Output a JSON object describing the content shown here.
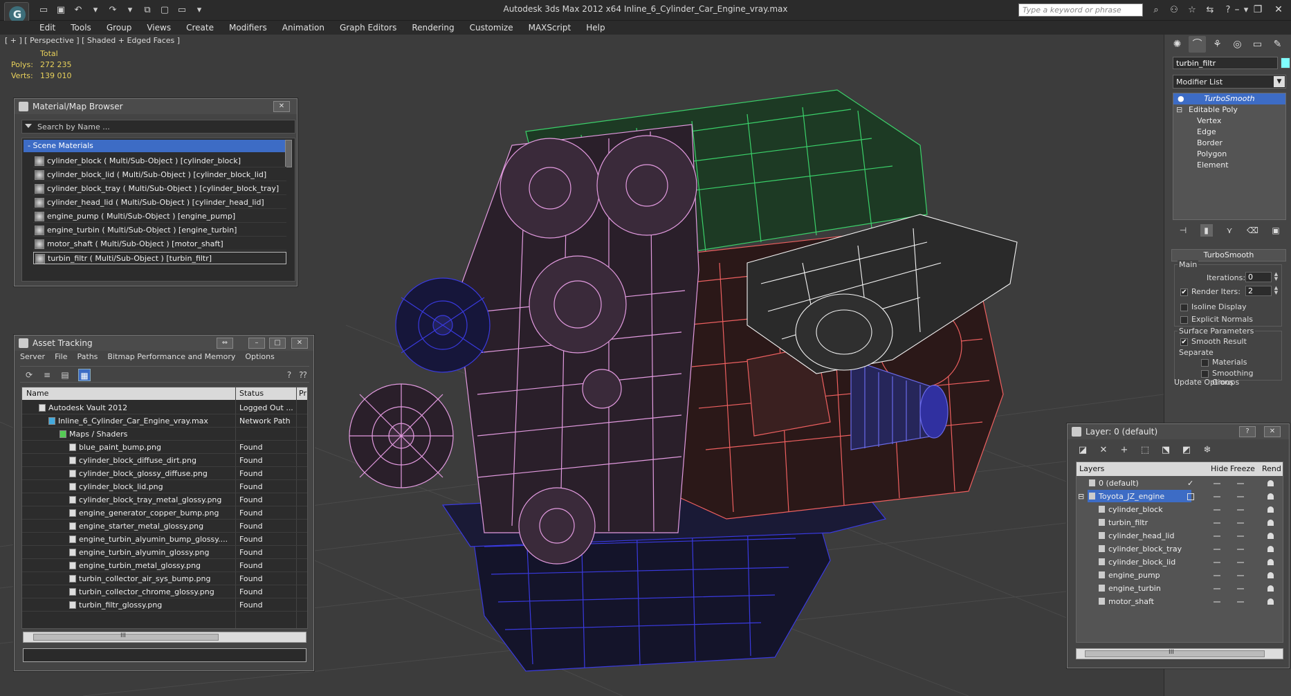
{
  "app": {
    "window_title": "Autodesk 3ds Max  2012 x64      Inline_6_Cylinder_Car_Engine_vray.max",
    "logo_letter": "G"
  },
  "search": {
    "placeholder": "Type a keyword or phrase"
  },
  "menu": [
    "Edit",
    "Tools",
    "Group",
    "Views",
    "Create",
    "Modifiers",
    "Animation",
    "Graph Editors",
    "Rendering",
    "Customize",
    "MAXScript",
    "Help"
  ],
  "viewport": {
    "label": "[ + ] [ Perspective ] [ Shaded + Edged Faces ]",
    "stats": {
      "header": "Total",
      "polys_label": "Polys:",
      "polys": "272 235",
      "verts_label": "Verts:",
      "verts": "139 010"
    }
  },
  "command_panel": {
    "object_name": "turbin_filtr",
    "object_color": "#80ffff",
    "modifier_list": "Modifier List",
    "stack": {
      "turbosmooth": "TurboSmooth",
      "editable_poly": "Editable Poly",
      "subobjects": [
        "Vertex",
        "Edge",
        "Border",
        "Polygon",
        "Element"
      ]
    },
    "turbosmooth": {
      "title": "TurboSmooth",
      "main_label": "Main",
      "iterations_label": "Iterations:",
      "iterations": "0",
      "render_iters_label": "Render Iters:",
      "render_iters": "2",
      "render_iters_checked": "✔",
      "isoline_label": "Isoline Display",
      "explicit_normals_label": "Explicit Normals",
      "surface_params_label": "Surface Parameters",
      "smooth_result_label": "Smooth Result",
      "smooth_result_checked": "✔",
      "separate_label": "Separate",
      "materials_label": "Materials",
      "smoothing_groups_label": "Smoothing Groups",
      "update_options_label": "Update Options"
    }
  },
  "material_browser": {
    "title": "Material/Map Browser",
    "search_placeholder": "Search by Name ...",
    "category": "- Scene Materials",
    "materials": [
      "cylinder_block  ( Multi/Sub-Object ) [cylinder_block]",
      "cylinder_block_lid  ( Multi/Sub-Object ) [cylinder_block_lid]",
      "cylinder_block_tray  ( Multi/Sub-Object ) [cylinder_block_tray]",
      "cylinder_head_lid  ( Multi/Sub-Object ) [cylinder_head_lid]",
      "engine_pump  ( Multi/Sub-Object ) [engine_pump]",
      "engine_turbin  ( Multi/Sub-Object ) [engine_turbin]",
      "motor_shaft  ( Multi/Sub-Object ) [motor_shaft]",
      "turbin_filtr  ( Multi/Sub-Object ) [turbin_filtr]"
    ],
    "close_glyph": "✕"
  },
  "asset_tracking": {
    "title": "Asset Tracking",
    "menu": [
      "Server",
      "File",
      "Paths",
      "Bitmap Performance and Memory",
      "Options"
    ],
    "columns": {
      "name": "Name",
      "status": "Status",
      "p": "Pr"
    },
    "rows": [
      {
        "name": "Autodesk Vault 2012",
        "status": "Logged Out ..."
      },
      {
        "name": "Inline_6_Cylinder_Car_Engine_vray.max",
        "status": "Network Path"
      },
      {
        "name": "Maps / Shaders",
        "status": ""
      },
      {
        "name": "blue_paint_bump.png",
        "status": "Found"
      },
      {
        "name": "cylinder_block_diffuse_dirt.png",
        "status": "Found"
      },
      {
        "name": "cylinder_block_glossy_diffuse.png",
        "status": "Found"
      },
      {
        "name": "cylinder_block_lid.png",
        "status": "Found"
      },
      {
        "name": "cylinder_block_tray_metal_glossy.png",
        "status": "Found"
      },
      {
        "name": "engine_generator_copper_bump.png",
        "status": "Found"
      },
      {
        "name": "engine_starter_metal_glossy.png",
        "status": "Found"
      },
      {
        "name": "engine_turbin_alyumin_bump_glossy....",
        "status": "Found"
      },
      {
        "name": "engine_turbin_alyumin_glossy.png",
        "status": "Found"
      },
      {
        "name": "engine_turbin_metal_glossy.png",
        "status": "Found"
      },
      {
        "name": "turbin_collector_air_sys_bump.png",
        "status": "Found"
      },
      {
        "name": "turbin_collector_chrome_glossy.png",
        "status": "Found"
      },
      {
        "name": "turbin_filtr_glossy.png",
        "status": "Found"
      }
    ],
    "scroll_thumb": "III"
  },
  "layer_panel": {
    "title": "Layer: 0 (default)",
    "columns": {
      "layers": "Layers",
      "hide": "Hide",
      "freeze": "Freeze",
      "render": "Rend"
    },
    "default_layer": "0 (default)",
    "default_check": "✓",
    "selected_layer": "Toyota_JZ_engine",
    "objects": [
      "cylinder_block",
      "turbin_filtr",
      "cylinder_head_lid",
      "cylinder_block_tray",
      "cylinder_block_lid",
      "engine_pump",
      "engine_turbin",
      "motor_shaft"
    ],
    "help_glyph": "?",
    "close_glyph": "✕",
    "scroll_thumb": "III"
  },
  "colors": {
    "green_wire": "#3bd16a",
    "pink_wire": "#e39be0",
    "blue_wire": "#3a3ae0",
    "red_wire": "#ee6060",
    "white_wire": "#f4f4f4",
    "selection_blue": "#3d6cc5"
  }
}
